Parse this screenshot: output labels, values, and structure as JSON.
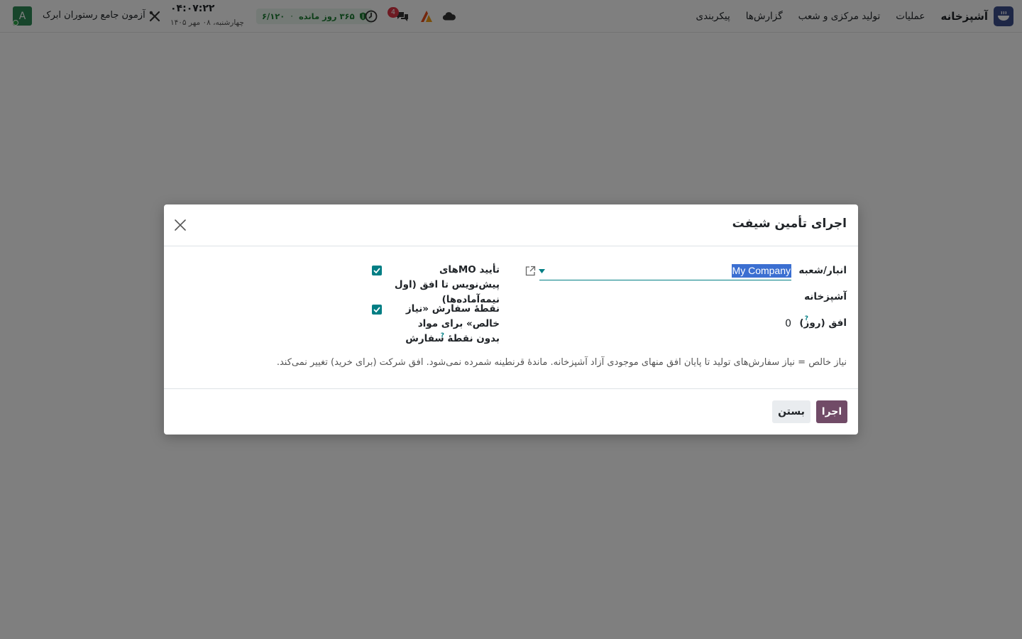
{
  "navbar": {
    "app_name": "آشپزخانه",
    "menu": [
      "عملیات",
      "تولید مرکزی و شعب",
      "گزارش‌ها",
      "پیکربندی"
    ],
    "avatar_letter": "A",
    "company": "آزمون جامع رستوران ابرک",
    "clock_time": "۰۴:۰۷:۲۲",
    "clock_date": "چهارشنبه، ۰۸ مهر ۱۴۰۵",
    "license_remaining": "۳۶۵ روز مانده",
    "license_ratio": "۶/۱۲۰",
    "chat_count": "4"
  },
  "dialog": {
    "title": "اجرای تأمین شیفت",
    "fields": {
      "warehouse_label": "انبار/شعبه",
      "warehouse_value": "My Company",
      "kitchen_label": "آشپزخانه",
      "horizon_label": "افق (روز)",
      "horizon_value": "0",
      "help_mark": "?"
    },
    "options": {
      "confirm_mo_label": "تأیید MOهای پیش‌نویس تا افق (اول نیمه‌آماده‌ها)",
      "net_need_label": "نقطهٔ سفارش «نیاز خالص» برای مواد بدون نقطهٔ سفارش"
    },
    "help_text": "نیاز خالص = نیاز سفارش‌های تولید تا پایان افق منهای موجودی آزاد آشپزخانه. ماندهٔ قرنطینه شمرده نمی‌شود. افق شرکت (برای خرید) تغییر نمی‌کند.",
    "buttons": {
      "run": "اجرا",
      "close": "بستن"
    }
  },
  "colors": {
    "primary": "#714b67",
    "accent": "#017e84",
    "selection": "#3b6fd1"
  }
}
